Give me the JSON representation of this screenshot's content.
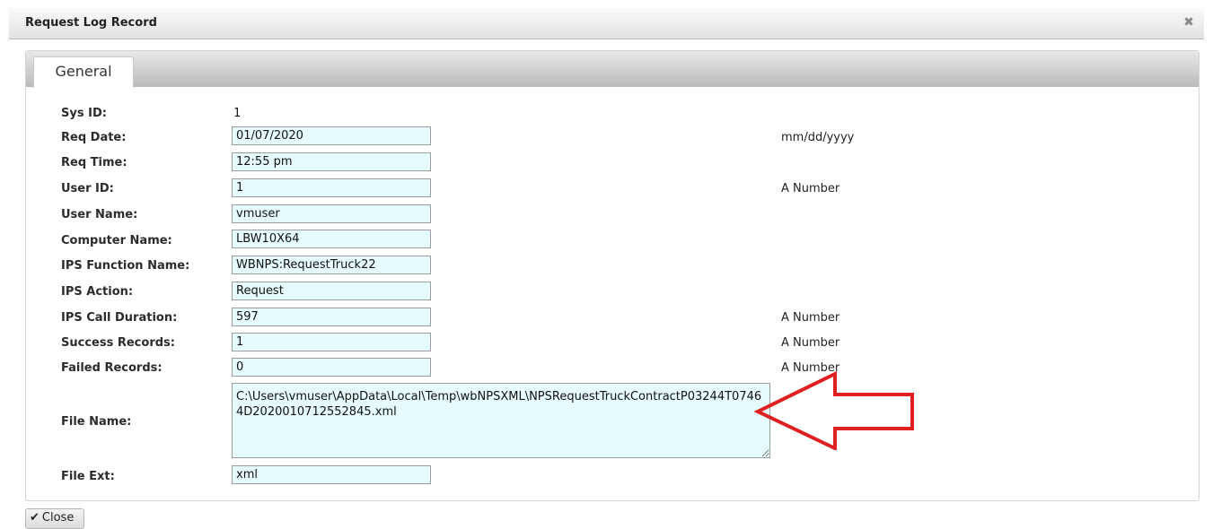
{
  "dialog": {
    "title": "Request Log Record",
    "close_icon": "close-icon"
  },
  "tabs": [
    {
      "label": "General",
      "active": true
    }
  ],
  "fields": {
    "sys_id": {
      "label": "Sys ID:",
      "value": "1"
    },
    "req_date": {
      "label": "Req Date:",
      "value": "01/07/2020",
      "hint": "mm/dd/yyyy"
    },
    "req_time": {
      "label": "Req Time:",
      "value": "12:55 pm"
    },
    "user_id": {
      "label": "User ID:",
      "value": "1",
      "hint": "A Number"
    },
    "user_name": {
      "label": "User Name:",
      "value": "vmuser"
    },
    "computer_name": {
      "label": "Computer Name:",
      "value": "LBW10X64"
    },
    "ips_function_name": {
      "label": "IPS Function Name:",
      "value": "WBNPS:RequestTruck22"
    },
    "ips_action": {
      "label": "IPS Action:",
      "value": "Request"
    },
    "ips_call_duration": {
      "label": "IPS Call Duration:",
      "value": "597",
      "hint": "A Number"
    },
    "success_records": {
      "label": "Success Records:",
      "value": "1",
      "hint": "A Number"
    },
    "failed_records": {
      "label": "Failed Records:",
      "value": "0",
      "hint": "A Number"
    },
    "file_name": {
      "label": "File Name:",
      "value": "C:\\Users\\vmuser\\AppData\\Local\\Temp\\wbNPSXML\\NPSRequestTruckContractP03244T07464D2020010712552845.xml"
    },
    "file_ext": {
      "label": "File Ext:",
      "value": "xml"
    }
  },
  "annotation": {
    "shape": "red outline arrow",
    "color": "#e02020"
  },
  "footer": {
    "close_label": "Close",
    "check_icon": "check-icon"
  },
  "colors": {
    "input_bg": "#e6fbfd",
    "arrow": "#e02020"
  }
}
